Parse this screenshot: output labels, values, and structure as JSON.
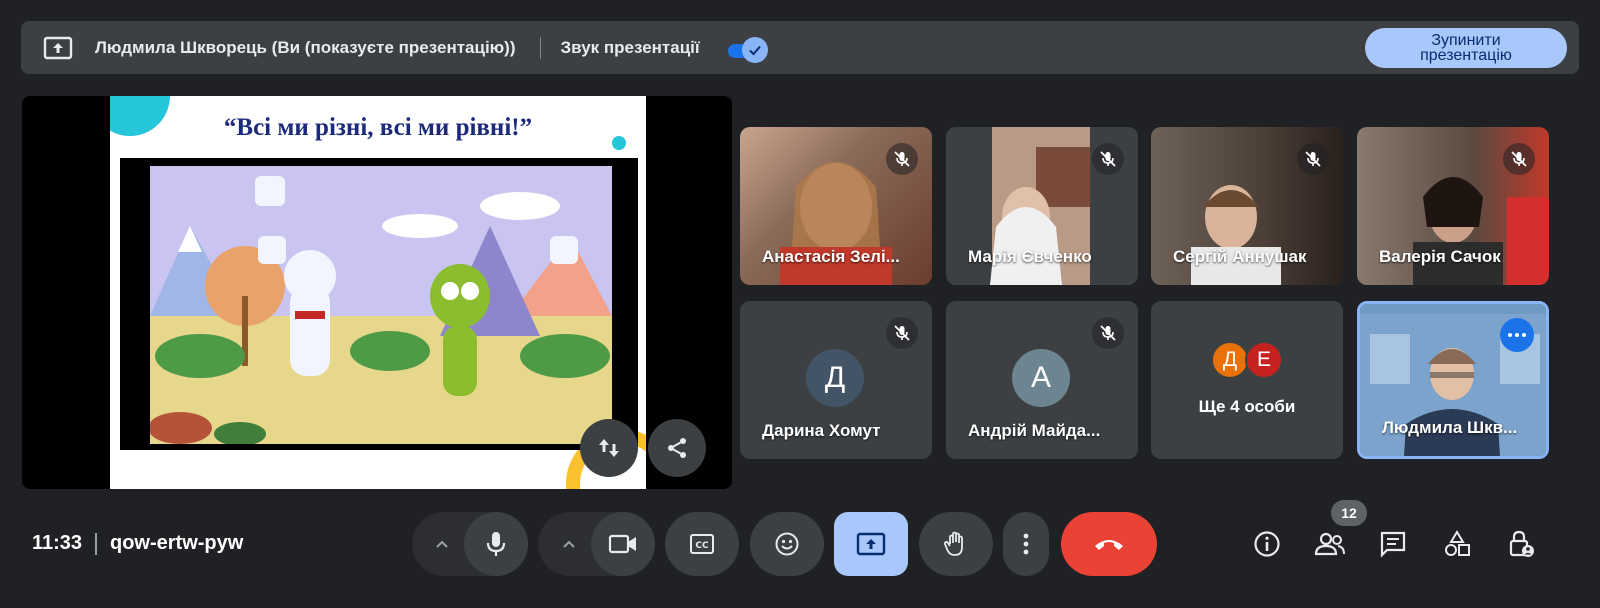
{
  "banner": {
    "presenter_text": "Людмила Шкворець (Ви (показуєте презентацію))",
    "sound_label": "Звук презентації",
    "sound_enabled": true,
    "stop_button_line1": "Зупинити",
    "stop_button_line2": "презентацію"
  },
  "slide": {
    "title": "“Всі ми різні, всі ми рівні!”"
  },
  "participants": [
    {
      "name": "Анастасія Зелі...",
      "muted": true
    },
    {
      "name": "Марія Євченко",
      "muted": true
    },
    {
      "name": "Сергій Аннушак",
      "muted": true
    },
    {
      "name": "Валерія Сачок",
      "muted": true
    },
    {
      "name": "Дарина Хомут",
      "initial": "Д",
      "muted": true
    },
    {
      "name": "Андрій Майда...",
      "initial": "А",
      "muted": true
    },
    {
      "name": "Ще 4 особи",
      "avatars": [
        "Д",
        "Е"
      ]
    },
    {
      "name": "Людмила Шкв..."
    }
  ],
  "bottom_bar": {
    "time": "11:33",
    "meeting_code": "qow-ertw-pyw",
    "participants_count": "12"
  },
  "colors": {
    "background": "#202124",
    "surface": "#3c4043",
    "accent": "#8ab4f8",
    "end_call": "#ea4335",
    "present_active": "#a8c7fa"
  }
}
